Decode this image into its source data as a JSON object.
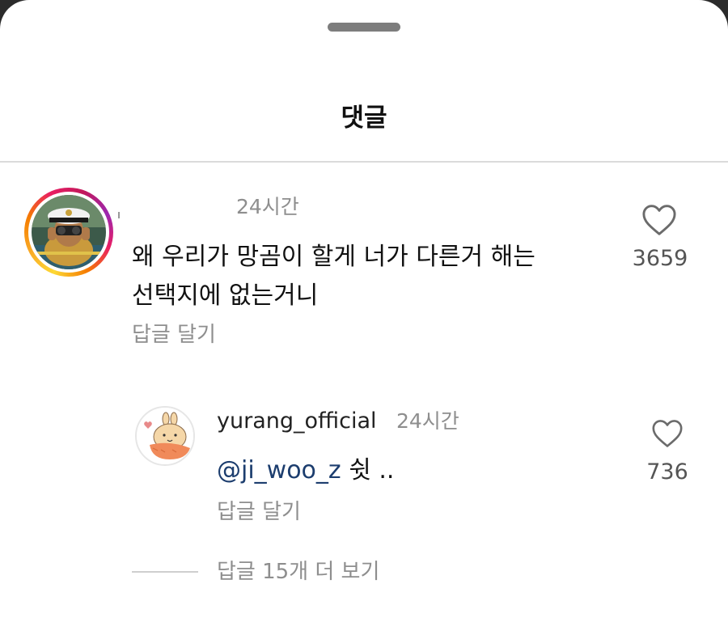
{
  "header": {
    "title": "댓글"
  },
  "comment": {
    "time": "24시간",
    "text_line1": "왜 우리가 망곰이 할게 너가 다른거 해는",
    "text_line2": "선택지에 없는거니",
    "reply_label": "답글 달기",
    "likes": "3659",
    "like_icon": "heart-outline"
  },
  "reply": {
    "username": "yurang_official",
    "time": "24시간",
    "mention": "@ji_woo_z",
    "text": " 쉿 ..",
    "reply_label": "답글 달기",
    "likes": "736",
    "like_icon": "heart-outline"
  },
  "more_replies": {
    "label": "답글 15개 더 보기"
  },
  "colors": {
    "mention": "#1c3d6e",
    "secondary_text": "#8e8e8e",
    "divider": "#dbdbdb"
  }
}
